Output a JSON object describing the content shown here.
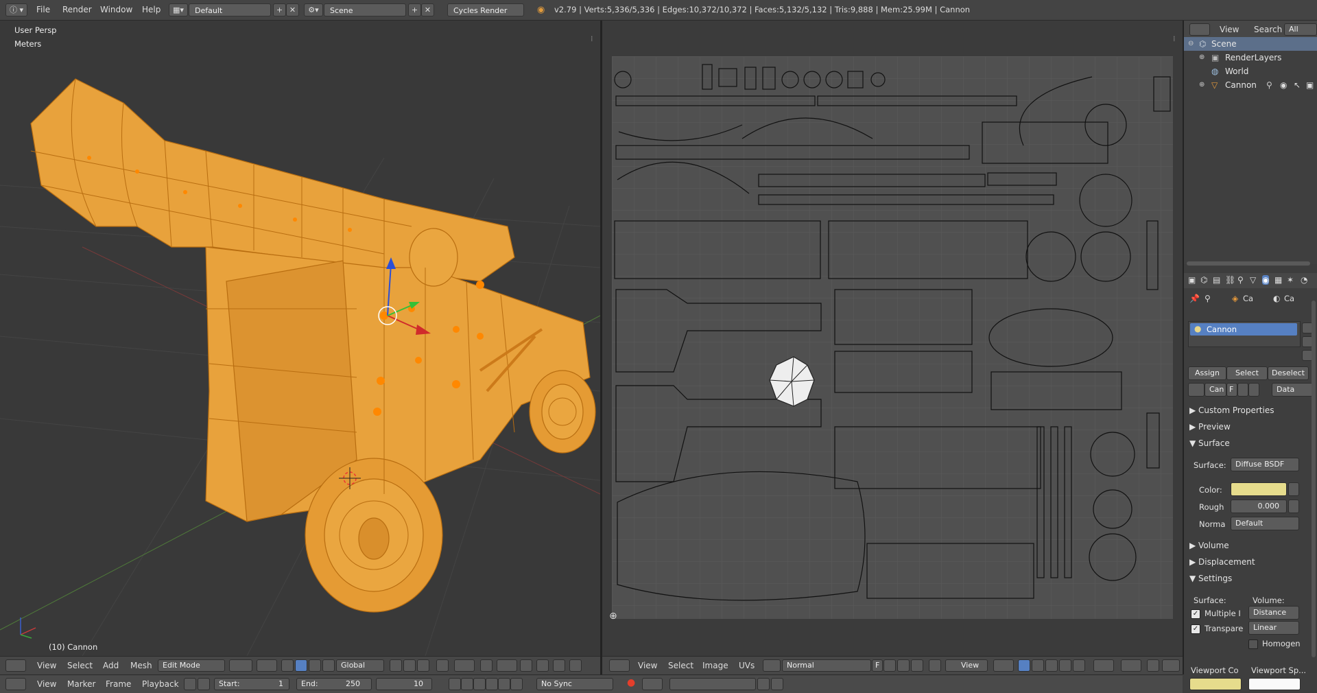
{
  "topbar": {
    "menus": [
      "File",
      "Render",
      "Window",
      "Help"
    ],
    "layout_name": "Default",
    "scene_name": "Scene",
    "render_engine": "Cycles Render",
    "stats": "v2.79 | Verts:5,336/5,336 | Edges:10,372/10,372 | Faces:5,132/5,132 | Tris:9,888 | Mem:25.99M | Cannon"
  },
  "viewport": {
    "view_name": "User Persp",
    "units": "Meters",
    "object_label": "(10) Cannon",
    "header": {
      "menus": [
        "View",
        "Select",
        "Add",
        "Mesh"
      ],
      "mode": "Edit Mode",
      "orientation": "Global"
    }
  },
  "uv_editor": {
    "header": {
      "menus": [
        "View",
        "Select",
        "Image",
        "UVs"
      ],
      "image_name": "Normal",
      "image_flag": "F",
      "view_btn": "View"
    }
  },
  "timeline": {
    "menus": [
      "View",
      "Marker",
      "Frame",
      "Playback"
    ],
    "start_label": "Start:",
    "start_value": "1",
    "end_label": "End:",
    "end_value": "250",
    "current_frame": "10",
    "sync": "No Sync"
  },
  "outliner": {
    "header": {
      "view": "View",
      "search": "Search",
      "filter": "All Scen"
    },
    "items": [
      {
        "label": "Scene",
        "selected": true
      },
      {
        "label": "RenderLayers"
      },
      {
        "label": "World"
      },
      {
        "label": "Cannon"
      }
    ]
  },
  "properties": {
    "breadcrumb": [
      "Ca",
      "Ca"
    ],
    "material_slot": "Cannon",
    "buttons": {
      "assign": "Assign",
      "select": "Select",
      "deselect": "Deselect"
    },
    "material_name": "Can",
    "material_flag": "F",
    "link": "Data",
    "sections": {
      "custom_properties": "Custom Properties",
      "preview": "Preview",
      "surface": "Surface",
      "volume": "Volume",
      "displacement": "Displacement",
      "settings": "Settings"
    },
    "surface": {
      "surface_label": "Surface:",
      "surface_value": "Diffuse BSDF",
      "color_label": "Color:",
      "color_value": "#e6dc8c",
      "rough_label": "Rough",
      "rough_value": "0.000",
      "normal_label": "Norma",
      "normal_value": "Default"
    },
    "settings": {
      "surface_col": "Surface:",
      "volume_col": "Volume:",
      "multiple_label": "Multiple I",
      "transparent_label": "Transpare",
      "distance_value": "Distance",
      "linear_value": "Linear",
      "homogen_label": "Homogen",
      "viewport_color": "Viewport Co",
      "viewport_spec": "Viewport Sp..."
    }
  },
  "colors": {
    "selection_orange": "#f5a53a",
    "accent_blue": "#5680c2",
    "panel_bg": "#3d3d3d"
  }
}
